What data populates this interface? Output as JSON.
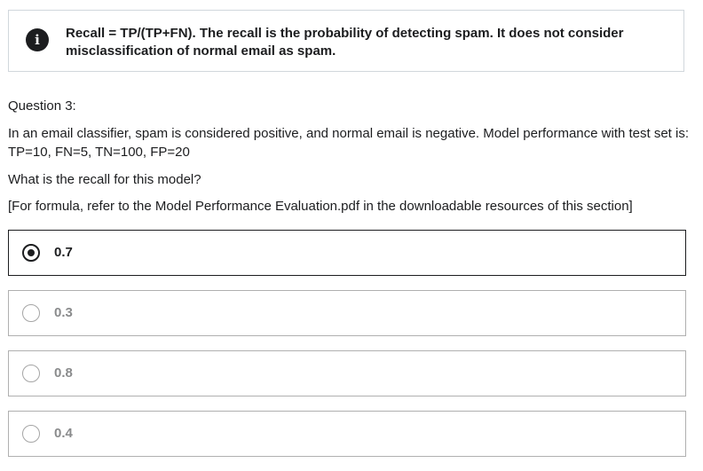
{
  "feedback": {
    "icon": "info-icon",
    "text": "Recall = TP/(TP+FN). The recall is the probability of detecting spam. It does not consider misclassification of normal email as spam."
  },
  "question": {
    "label": "Question 3:",
    "body": "In an email classifier, spam is considered positive, and normal email is negative.  Model performance with test set is: TP=10, FN=5, TN=100, FP=20",
    "ask": "What is the recall for this model?",
    "reference": "[For formula, refer to the Model Performance Evaluation.pdf in the downloadable resources of this section]"
  },
  "options": [
    {
      "label": "0.7",
      "selected": true
    },
    {
      "label": "0.3",
      "selected": false
    },
    {
      "label": "0.8",
      "selected": false
    },
    {
      "label": "0.4",
      "selected": false
    }
  ],
  "colors": {
    "text": "#1c1d1f",
    "border_default": "#b0b0b0",
    "border_selected": "#1c1d1f",
    "option_muted": "#8a8b8c"
  }
}
